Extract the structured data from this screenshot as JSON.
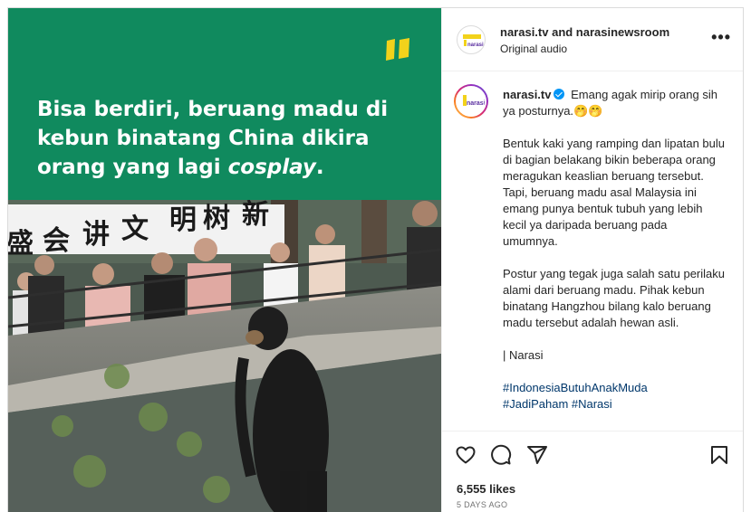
{
  "media": {
    "banner_line1": "Bisa berdiri, beruang madu di",
    "banner_line2": "kebun binatang China dikira",
    "banner_line3_prefix": "orang yang lagi ",
    "banner_line3_italic": "cosplay",
    "banner_line3_suffix": ".",
    "signboard_chars": [
      "盛",
      "会",
      "讲",
      "文",
      "明",
      "树",
      "新"
    ],
    "brand_color": "#108a5e",
    "logo_color": "#f2d21b"
  },
  "header": {
    "usernames": "narasi.tv and narasinewsroom",
    "audio": "Original audio",
    "more_icon": "more-horizontal-icon"
  },
  "caption": {
    "username": "narasi.tv",
    "verified_icon": "verified-badge-icon",
    "line_intro": "Emang agak mirip orang sih ya posturnya.🤭🤭",
    "para1": "Bentuk kaki yang ramping dan lipatan bulu di bagian belakang bikin beberapa orang meragukan keaslian beruang tersebut. Tapi, beruang madu asal Malaysia ini emang punya bentuk tubuh yang lebih kecil ya daripada beruang pada umumnya.",
    "para2": "Postur yang tegak juga salah satu perilaku alami dari beruang madu. Pihak kebun binatang Hangzhou bilang kalo beruang madu tersebut adalah hewan asli.",
    "para3": "| Narasi",
    "hashtags_line1": "#IndonesiaButuhAnakMuda",
    "hashtags_line2": "#JadiPaham #Narasi"
  },
  "actions": {
    "like_icon": "heart-icon",
    "comment_icon": "comment-icon",
    "share_icon": "share-icon",
    "save_icon": "bookmark-icon",
    "likes": "6,555 likes",
    "date": "5 DAYS AGO"
  },
  "avatar_logo_text": "narasi"
}
